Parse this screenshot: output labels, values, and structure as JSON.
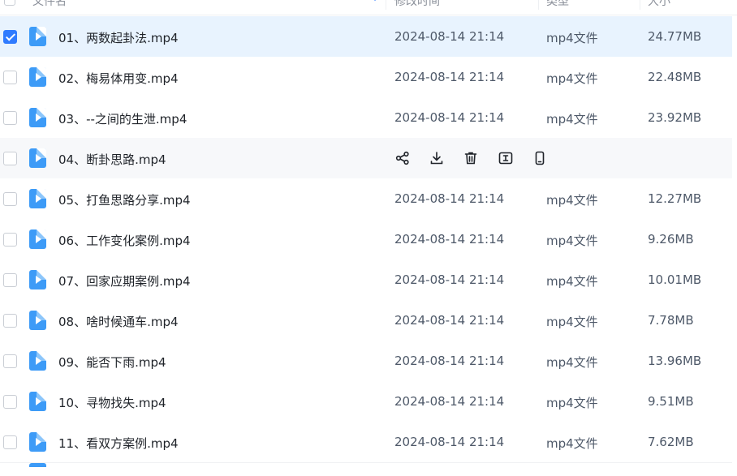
{
  "header": {
    "name_label": "文件名",
    "time_label": "修改时间",
    "type_label": "类型",
    "size_label": "大小",
    "sort_indicator": "↑"
  },
  "files": [
    {
      "name": "01、两数起卦法.mp4",
      "time": "2024-08-14 21:14",
      "type": "mp4文件",
      "size": "24.77MB",
      "checked": true
    },
    {
      "name": "02、梅易体用变.mp4",
      "time": "2024-08-14 21:14",
      "type": "mp4文件",
      "size": "22.48MB"
    },
    {
      "name": "03、--之间的生泄.mp4",
      "time": "2024-08-14 21:14",
      "type": "mp4文件",
      "size": "23.92MB"
    },
    {
      "name": "04、断卦思路.mp4",
      "hovered": true
    },
    {
      "name": "05、打鱼思路分享.mp4",
      "time": "2024-08-14 21:14",
      "type": "mp4文件",
      "size": "12.27MB"
    },
    {
      "name": "06、工作变化案例.mp4",
      "time": "2024-08-14 21:14",
      "type": "mp4文件",
      "size": "9.26MB"
    },
    {
      "name": "07、回家应期案例.mp4",
      "time": "2024-08-14 21:14",
      "type": "mp4文件",
      "size": "10.01MB"
    },
    {
      "name": "08、啥时候通车.mp4",
      "time": "2024-08-14 21:14",
      "type": "mp4文件",
      "size": "7.78MB"
    },
    {
      "name": "09、能否下雨.mp4",
      "time": "2024-08-14 21:14",
      "type": "mp4文件",
      "size": "13.96MB"
    },
    {
      "name": "10、寻物找失.mp4",
      "time": "2024-08-14 21:14",
      "type": "mp4文件",
      "size": "9.51MB"
    },
    {
      "name": "11、看双方案例.mp4",
      "time": "2024-08-14 21:14",
      "type": "mp4文件",
      "size": "7.62MB"
    }
  ],
  "row_actions": [
    {
      "icon": "share-icon"
    },
    {
      "icon": "download-icon"
    },
    {
      "icon": "trash-icon"
    },
    {
      "icon": "rename-icon"
    },
    {
      "icon": "mobile-icon"
    }
  ],
  "colors": {
    "accent": "#2f7bff",
    "selected_bg": "#e8f3fe",
    "hover_bg": "#f7f8fa",
    "file_icon": "#3d9bf7"
  }
}
